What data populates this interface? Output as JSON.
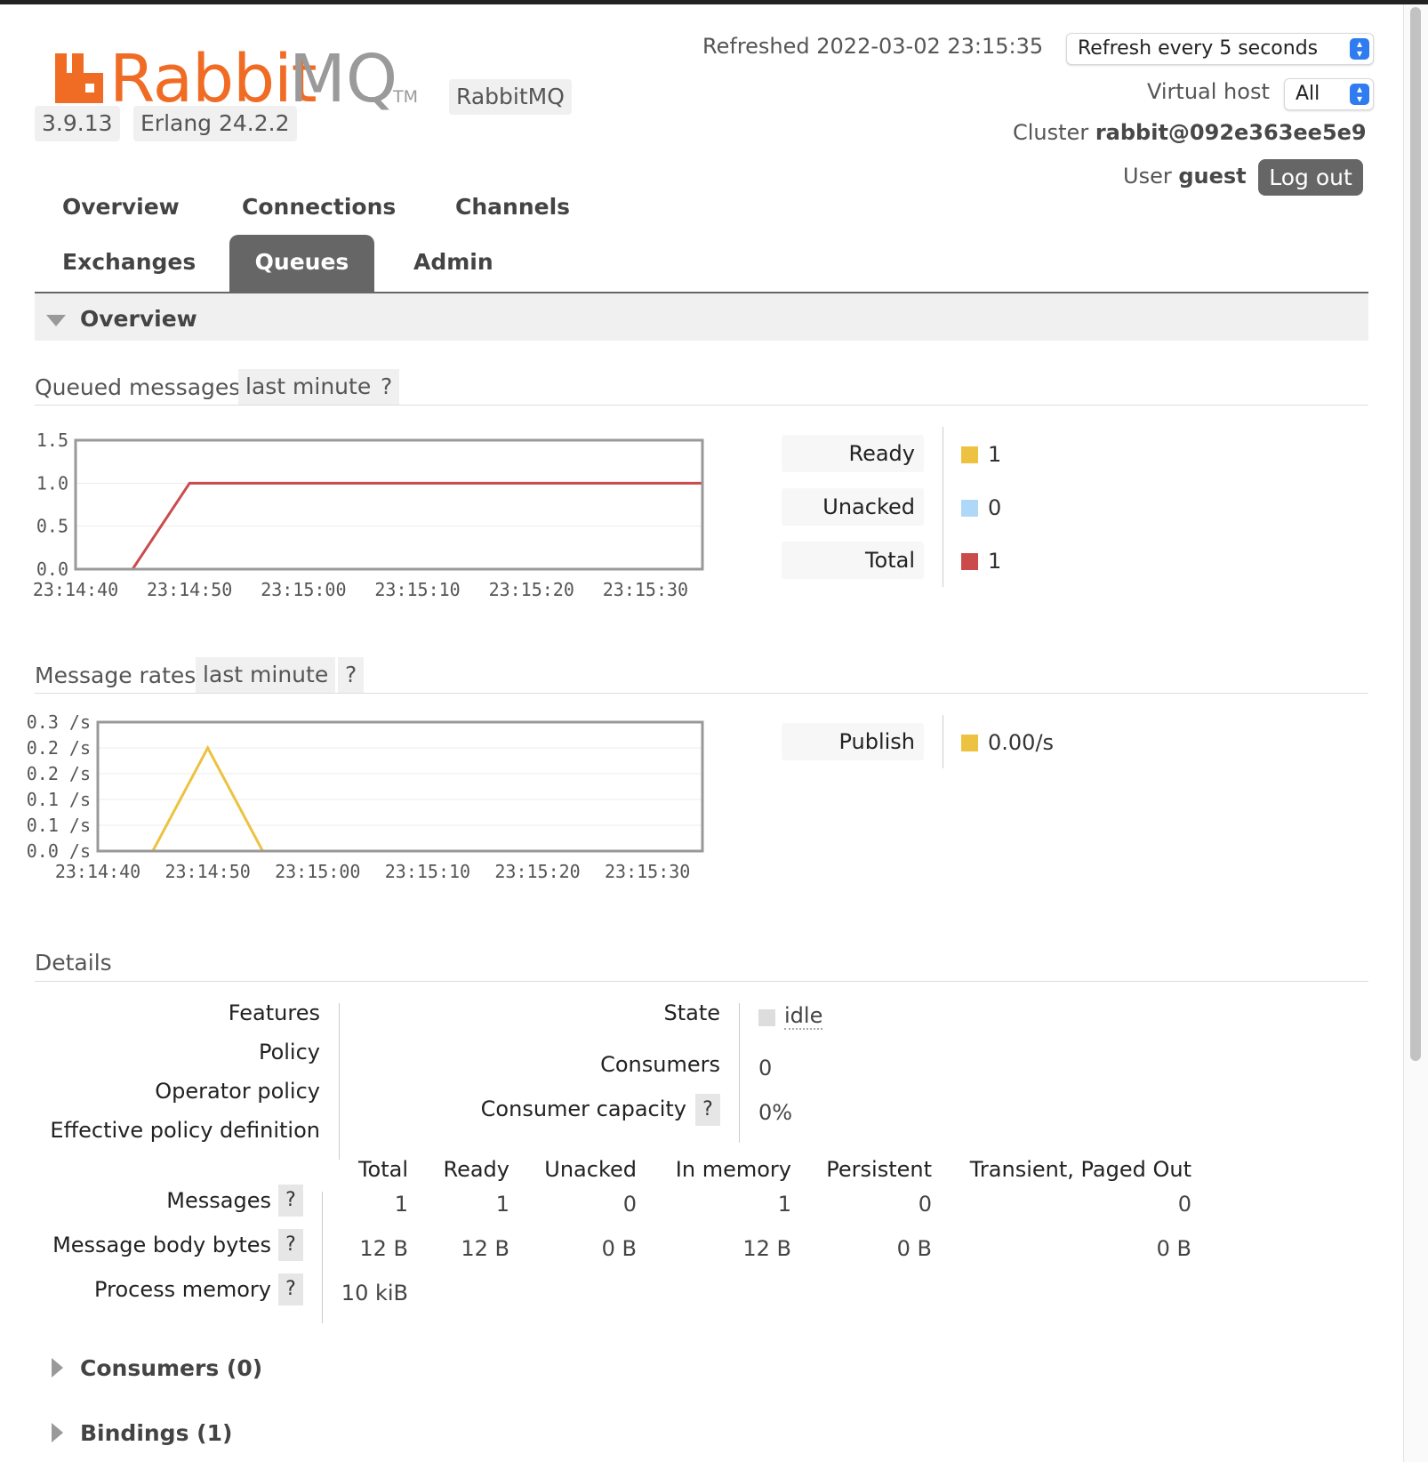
{
  "header": {
    "brand_rabbit": "Rabbit",
    "brand_mq": "MQ",
    "brand_tm": "TM",
    "version": "3.9.13",
    "erlang": "Erlang 24.2.2",
    "product_badge": "RabbitMQ",
    "refreshed": "Refreshed 2022-03-02 23:15:35",
    "refresh_select": "Refresh every 5 seconds",
    "vhost_label": "Virtual host",
    "vhost_select": "All",
    "cluster_label": "Cluster",
    "cluster_name": "rabbit@092e363ee5e9",
    "user_label": "User",
    "user_name": "guest",
    "logout_label": "Log out"
  },
  "tabs": {
    "overview": "Overview",
    "connections": "Connections",
    "channels": "Channels",
    "exchanges": "Exchanges",
    "queues": "Queues",
    "admin": "Admin",
    "active": "Queues"
  },
  "overview_section": {
    "title": "Overview"
  },
  "queued_messages": {
    "title": "Queued messages",
    "range": "last minute",
    "help": "?",
    "legend": [
      {
        "label": "Ready",
        "value": "1",
        "color": "#edc240"
      },
      {
        "label": "Unacked",
        "value": "0",
        "color": "#afd8f8"
      },
      {
        "label": "Total",
        "value": "1",
        "color": "#cb4b4b"
      }
    ]
  },
  "message_rates": {
    "title": "Message rates",
    "range": "last minute",
    "help": "?",
    "legend": [
      {
        "label": "Publish",
        "value": "0.00/s",
        "color": "#edc240"
      }
    ]
  },
  "chart_data": [
    {
      "type": "line",
      "title": "Queued messages",
      "x": [
        "23:14:40",
        "23:14:45",
        "23:14:50",
        "23:14:55",
        "23:15:00",
        "23:15:05",
        "23:15:10",
        "23:15:15",
        "23:15:20",
        "23:15:25",
        "23:15:30",
        "23:15:35"
      ],
      "x_ticks": [
        "23:14:40",
        "23:14:50",
        "23:15:00",
        "23:15:10",
        "23:15:20",
        "23:15:30"
      ],
      "y_ticks": [
        "1.5",
        "1.0",
        "0.5",
        "0.0"
      ],
      "ylim": [
        0,
        1.5
      ],
      "grid": true,
      "series": [
        {
          "name": "Total",
          "color": "#cb4b4b",
          "values": [
            0,
            0,
            1,
            1,
            1,
            1,
            1,
            1,
            1,
            1,
            1,
            1
          ]
        },
        {
          "name": "Unacked",
          "color": "#afd8f8",
          "values": [
            0,
            0,
            0,
            0,
            0,
            0,
            0,
            0,
            0,
            0,
            0,
            0
          ]
        }
      ]
    },
    {
      "type": "line",
      "title": "Message rates",
      "x": [
        "23:14:40",
        "23:14:45",
        "23:14:50",
        "23:14:55",
        "23:15:00",
        "23:15:05",
        "23:15:10",
        "23:15:15",
        "23:15:20",
        "23:15:25",
        "23:15:30",
        "23:15:35"
      ],
      "x_ticks": [
        "23:14:40",
        "23:14:50",
        "23:15:00",
        "23:15:10",
        "23:15:20",
        "23:15:30"
      ],
      "y_ticks": [
        "0.3 /s",
        "0.2 /s",
        "0.2 /s",
        "0.1 /s",
        "0.1 /s",
        "0.0 /s"
      ],
      "ylim": [
        0,
        0.25
      ],
      "grid": true,
      "series": [
        {
          "name": "Publish",
          "color": "#edc240",
          "values": [
            0,
            0,
            0.2,
            0,
            0,
            0,
            0,
            0,
            0,
            0,
            0,
            0
          ]
        }
      ]
    }
  ],
  "details": {
    "title": "Details",
    "features_label": "Features",
    "policy_label": "Policy",
    "operator_policy_label": "Operator policy",
    "effective_policy_label": "Effective policy definition",
    "state_label": "State",
    "state_value": "idle",
    "consumers_label": "Consumers",
    "consumers_value": "0",
    "consumer_capacity_label": "Consumer capacity",
    "consumer_capacity_value": "0%",
    "help": "?",
    "columns": [
      "Total",
      "Ready",
      "Unacked",
      "In memory",
      "Persistent",
      "Transient, Paged Out"
    ],
    "rows": [
      {
        "label": "Messages",
        "values": [
          "1",
          "1",
          "0",
          "1",
          "0",
          "0"
        ]
      },
      {
        "label": "Message body bytes",
        "values": [
          "12 B",
          "12 B",
          "0 B",
          "12 B",
          "0 B",
          "0 B"
        ]
      }
    ],
    "process_memory_label": "Process memory",
    "process_memory_value": "10 kiB"
  },
  "collapsed_sections": {
    "consumers": "Consumers (0)",
    "bindings": "Bindings (1)"
  }
}
